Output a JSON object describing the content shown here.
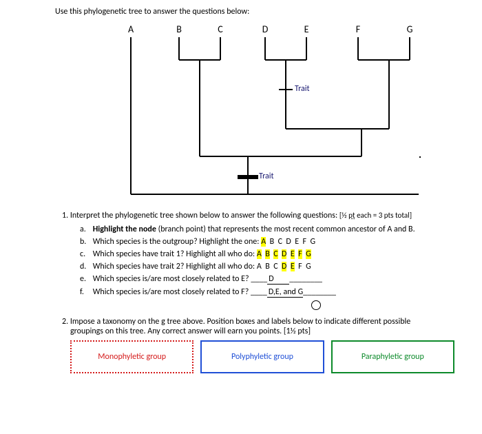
{
  "intro": "Use this phylogenetic tree to answer the questions below:",
  "tree": {
    "tips": [
      "A",
      "B",
      "C",
      "D",
      "E",
      "F",
      "G"
    ],
    "trait_upper": "Trait",
    "trait_lower": "Trait"
  },
  "chart_data": {
    "type": "diagram",
    "title": "Phylogenetic tree",
    "tips": [
      "A",
      "B",
      "C",
      "D",
      "E",
      "F",
      "G"
    ],
    "topology": "(A,((B,C),((D,E),(F,G))))",
    "trait_marks": [
      {
        "label": "Trait",
        "on_branch_of_clade": "(D,E)",
        "note": "upper tick on DE stem"
      },
      {
        "label": "Trait",
        "on_branch_of_clade": "((B,C),((D,E),(F,G)))",
        "note": "lower tick on ingroup stem"
      }
    ],
    "outgroup": "A"
  },
  "q1": {
    "prompt_prefix": "1. Interpret the phylogenetic tree shown below to answer the following questions: ",
    "pts_prefix": "[½ ",
    "pts_word": "pt",
    "pts_suffix": " each = 3 pts total]",
    "a": {
      "letter": "a.",
      "bold": "Highlight the node",
      "rest": " (branch point) that represents the most recent common ancestor of A and B."
    },
    "b": {
      "letter": "b.",
      "text": "Which species is the outgroup? Highlight the one: ",
      "options": [
        "A",
        "B",
        "C",
        "D",
        "E",
        "F",
        "G"
      ],
      "highlight": [
        "A"
      ]
    },
    "c": {
      "letter": "c.",
      "text": "Which species have trait 1?  Highlight all who do: ",
      "options": [
        "A",
        "B",
        "C",
        "D",
        "E",
        "F",
        "G"
      ],
      "highlight": [
        "A",
        "B",
        "C",
        "D",
        "E",
        "F",
        "G"
      ]
    },
    "d": {
      "letter": "d.",
      "text": "Which species have trait 2?  Highlight all who do: ",
      "options": [
        "A",
        "B",
        "C",
        "D",
        "E",
        "F",
        "G"
      ],
      "highlight": [
        "D",
        "E"
      ]
    },
    "e": {
      "letter": "e.",
      "text": "Which species is/are most closely related to E? ",
      "blank_before": "____",
      "answer": "D",
      "blank_after": "________"
    },
    "f": {
      "letter": "f.",
      "text": "Which species is/are most closely related to F? ",
      "blank_before": "____",
      "answer": "D,E, and G",
      "blank_after": "________"
    }
  },
  "q2": {
    "line1": "2. Impose a taxonomy on the g tree above.  Position boxes and labels below to indicate different possible",
    "line2": "groupings on this tree.  Any correct answer will earn you points. [1½ pts]"
  },
  "groups": {
    "mono": "Monophyletic group",
    "poly": "Polyphyletic group",
    "para": "Paraphyletic group"
  }
}
